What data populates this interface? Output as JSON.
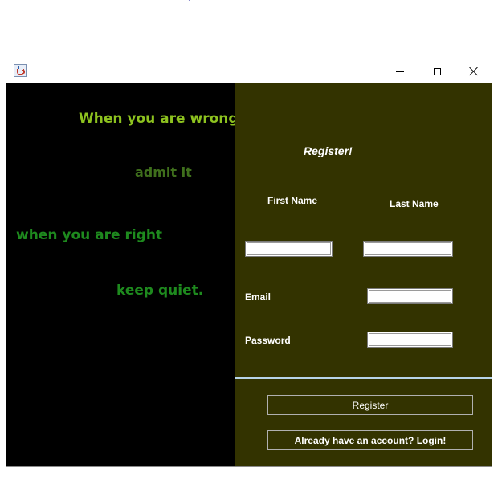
{
  "desktop": {
    "stray_mark": "'"
  },
  "window": {
    "title": "",
    "controls": {
      "minimize_icon": "minimize-icon",
      "maximize_icon": "maximize-icon",
      "close_icon": "close-icon"
    }
  },
  "quote": {
    "line1": "When you are wrong,",
    "line2": "admit it",
    "line3": "when you are right",
    "line4": "keep quiet."
  },
  "form": {
    "heading": "Register!",
    "first_name_label": "First Name",
    "last_name_label": "Last Name",
    "email_label": "Email",
    "password_label": "Password",
    "first_name_value": "",
    "last_name_value": "",
    "email_value": "",
    "password_value": "",
    "register_button": "Register",
    "login_button": "Already have an account? Login!"
  },
  "colors": {
    "left_panel_bg": "#000000",
    "right_panel_bg": "#333300",
    "quote_line1": "#8dc21f",
    "quote_line2": "#3f6f1c",
    "quote_line3": "#1e8a1e",
    "quote_line4": "#1e8a1e",
    "divider": "#b8d4e8"
  }
}
